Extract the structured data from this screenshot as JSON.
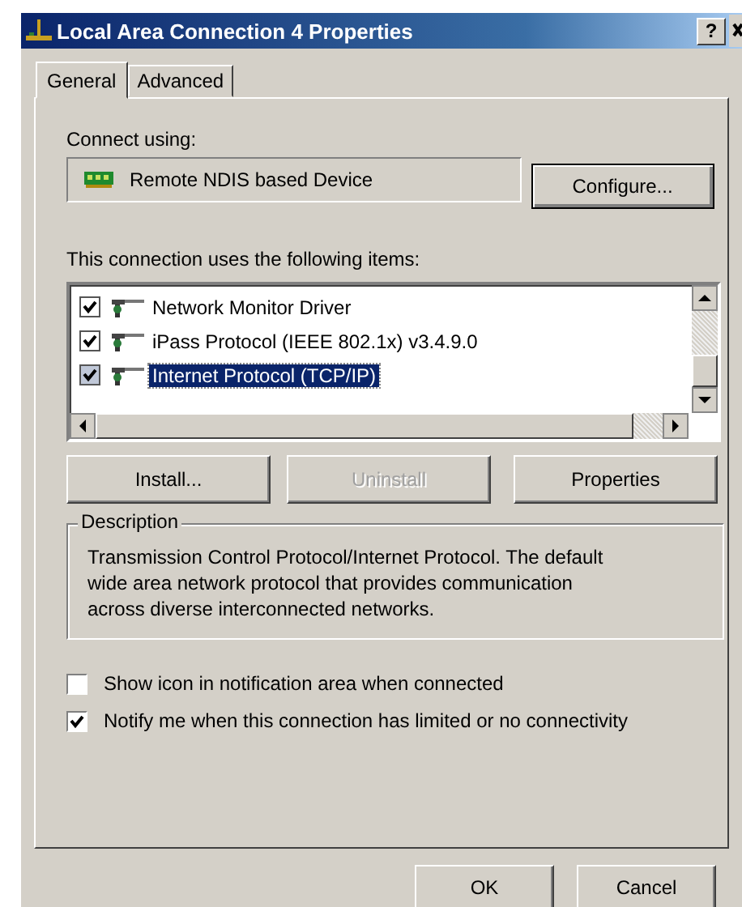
{
  "window": {
    "title": "Local Area Connection 4 Properties",
    "help_button": "?"
  },
  "tabs": [
    {
      "label": "General",
      "selected": true
    },
    {
      "label": "Advanced",
      "selected": false
    }
  ],
  "connect_using": {
    "label": "Connect using:",
    "device": "Remote NDIS based Device",
    "configure_button": "Configure..."
  },
  "items_label": "This connection uses the following items:",
  "items": [
    {
      "label": "Network Monitor Driver",
      "checked": true,
      "selected": false
    },
    {
      "label": "iPass Protocol (IEEE 802.1x) v3.4.9.0",
      "checked": true,
      "selected": false
    },
    {
      "label": "Internet Protocol (TCP/IP)",
      "checked": true,
      "selected": true
    }
  ],
  "item_buttons": [
    {
      "label": "Install...",
      "disabled": false
    },
    {
      "label": "Uninstall",
      "disabled": true
    },
    {
      "label": "Properties",
      "disabled": false
    }
  ],
  "description": {
    "title": "Description",
    "text": "Transmission Control Protocol/Internet Protocol. The default wide area network protocol that provides communication across diverse interconnected networks."
  },
  "options": [
    {
      "label": "Show icon in notification area when connected",
      "checked": false
    },
    {
      "label": "Notify me when this connection has limited or no connectivity",
      "checked": true
    }
  ],
  "dialog_buttons": [
    "OK",
    "Cancel"
  ]
}
